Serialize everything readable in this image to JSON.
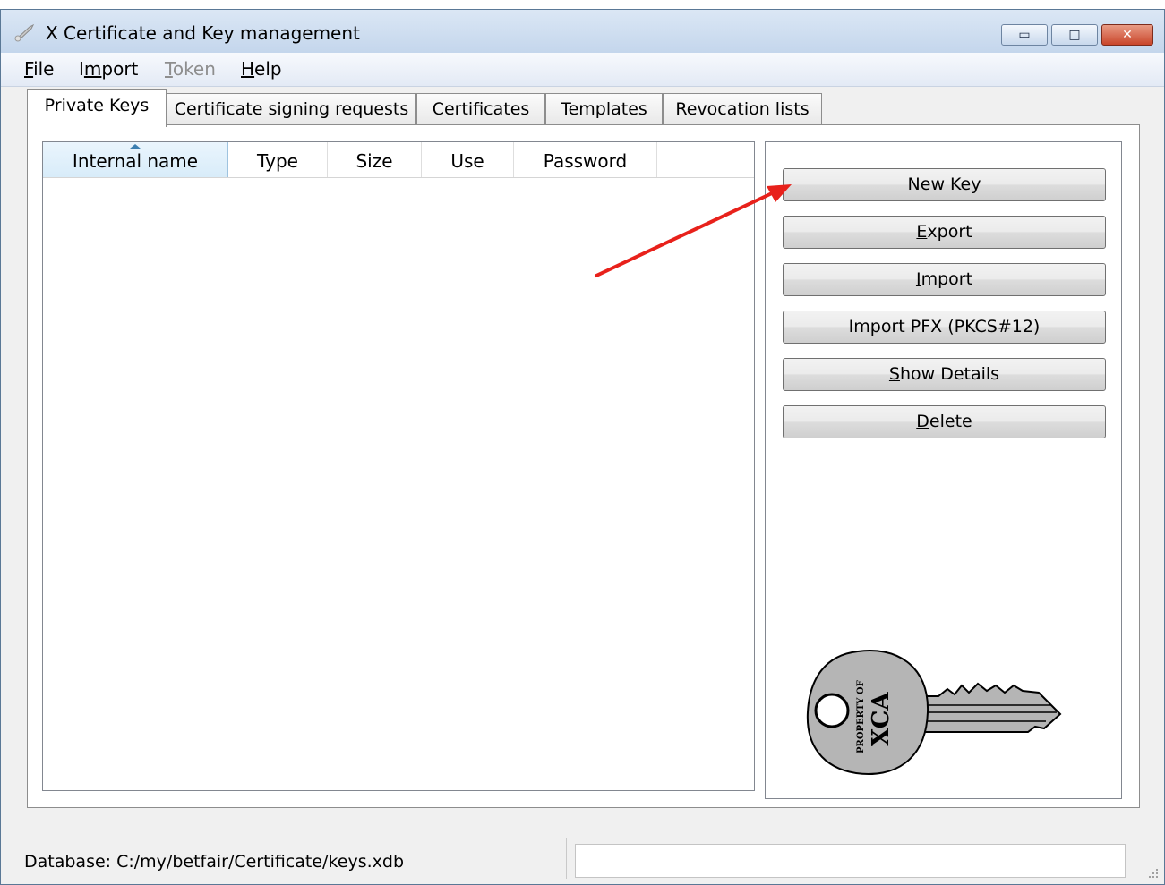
{
  "window": {
    "title": "X Certificate and Key management",
    "controls": {
      "minimize": "▭",
      "maximize": "□",
      "close": "✕"
    }
  },
  "menu": {
    "items": [
      {
        "label": "File",
        "underline": "F",
        "enabled": true
      },
      {
        "label": "Import",
        "underline": "m",
        "enabled": true
      },
      {
        "label": "Token",
        "underline": "T",
        "enabled": false
      },
      {
        "label": "Help",
        "underline": "H",
        "enabled": true
      }
    ]
  },
  "tabs": {
    "items": [
      {
        "label": "Private Keys",
        "active": true
      },
      {
        "label": "Certificate signing requests",
        "active": false
      },
      {
        "label": "Certificates",
        "active": false
      },
      {
        "label": "Templates",
        "active": false
      },
      {
        "label": "Revocation lists",
        "active": false
      }
    ]
  },
  "table": {
    "columns": [
      "Internal name",
      "Type",
      "Size",
      "Use",
      "Password"
    ],
    "sorted_column": "Internal name",
    "rows": []
  },
  "buttons": {
    "new_key": {
      "pre": "",
      "mnemonic": "N",
      "post": "ew Key"
    },
    "export": {
      "pre": "",
      "mnemonic": "E",
      "post": "xport"
    },
    "import": {
      "pre": "",
      "mnemonic": "I",
      "post": "mport"
    },
    "import_pfx": {
      "pre": "Import PFX (PKCS#12)",
      "mnemonic": "",
      "post": ""
    },
    "show_details": {
      "pre": "",
      "mnemonic": "S",
      "post": "how Details"
    },
    "delete": {
      "pre": "",
      "mnemonic": "D",
      "post": "elete"
    }
  },
  "key_image": {
    "line1": "PROPERTY OF",
    "line2": "XCA"
  },
  "status": {
    "database": "Database: C:/my/betfair/Certificate/keys.xdb",
    "message": ""
  },
  "colors": {
    "annotation_arrow": "#e8211b",
    "key_fill": "#b5b5b5",
    "sort_accent": "#3c7fb1"
  }
}
